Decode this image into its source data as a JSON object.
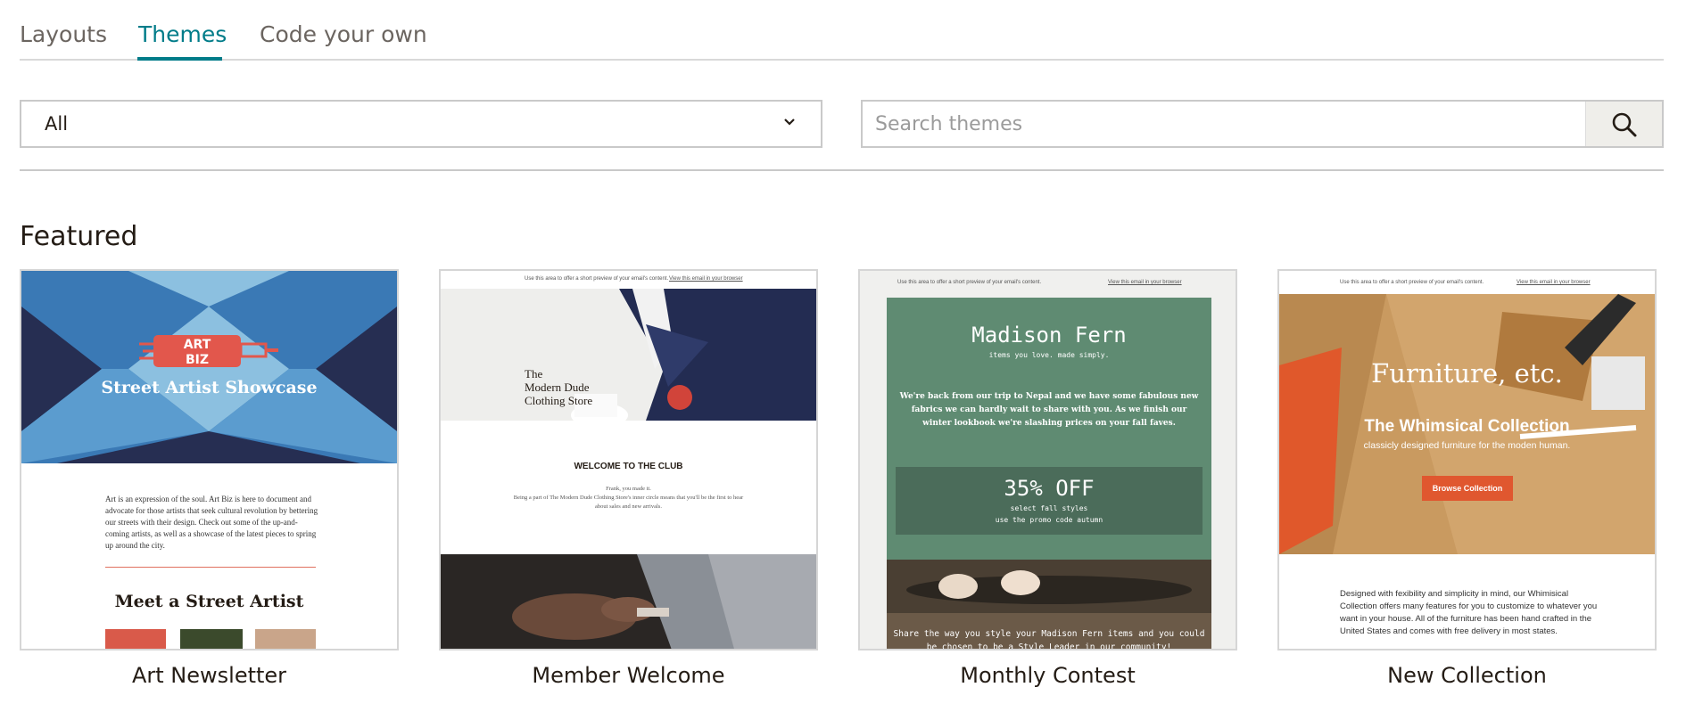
{
  "tabs": [
    {
      "label": "Layouts",
      "active": false
    },
    {
      "label": "Themes",
      "active": true
    },
    {
      "label": "Code your own",
      "active": false
    }
  ],
  "filter": {
    "selected": "All",
    "icon": "chevron-down-icon"
  },
  "search": {
    "placeholder": "Search themes",
    "value": "",
    "icon": "search-icon"
  },
  "section_title": "Featured",
  "colors": {
    "accent": "#007c89",
    "text": "#241c15",
    "border": "#c9c9c9"
  },
  "cards": [
    {
      "label": "Art Newsletter",
      "logo_line1": "ART",
      "logo_line2": "BIZ",
      "hero_title": "Street Artist Showcase",
      "body": "Art is an expression of the soul. Art Biz is here to document and advocate for those artists that seek cultural revolution by bettering our streets with their design. Check out some of the up-and-coming artists, as well as a showcase of the latest pieces to spring up around the city.",
      "subheading": "Meet a Street Artist"
    },
    {
      "label": "Member Welcome",
      "preheader": "Use this area to offer a short preview of your email's content.",
      "browser_link": "View this email in your browser",
      "brand_line1": "The",
      "brand_line2": "Modern Dude",
      "brand_line3": "Clothing Store",
      "heading": "WELCOME TO THE CLUB",
      "text_line1": "Frank, you made it.",
      "text_line2": "Being a part of The Modern Dude Clothing Store's inner circle means that you'll be the first to hear about sales and new arrivals."
    },
    {
      "label": "Monthly Contest",
      "preheader": "Use this area to offer a short preview of your email's content.",
      "browser_link": "View this email in your browser",
      "brand": "Madison Fern",
      "tagline": "items you love. made simply.",
      "body": "We're back from our trip to Nepal and we have some fabulous new fabrics we can hardly wait to share with you. As we finish our winter lookbook we're slashing prices on your fall faves.",
      "promo_title": "35% OFF",
      "promo_line1": "select fall styles",
      "promo_line2": "use the promo code autumn",
      "share": "Share the way you style your Madison Fern items and you could be chosen to be a Style Leader in our community!"
    },
    {
      "label": "New Collection",
      "preheader": "Use this area to offer a short preview of your email's content.",
      "browser_link": "View this email in your browser",
      "hero_title": "Furniture, etc.",
      "hero_sub": "The Whimsical Collection",
      "hero_small": "classicly designed furniture for the moden human.",
      "button": "Browse Collection",
      "body": "Designed with fexibility and simplicity in mind, our Whimisical Collection offers many features for you to customize to whatever you want in your house. All of the furniture has been hand crafted in the United States and comes with free delivery in most states."
    }
  ]
}
